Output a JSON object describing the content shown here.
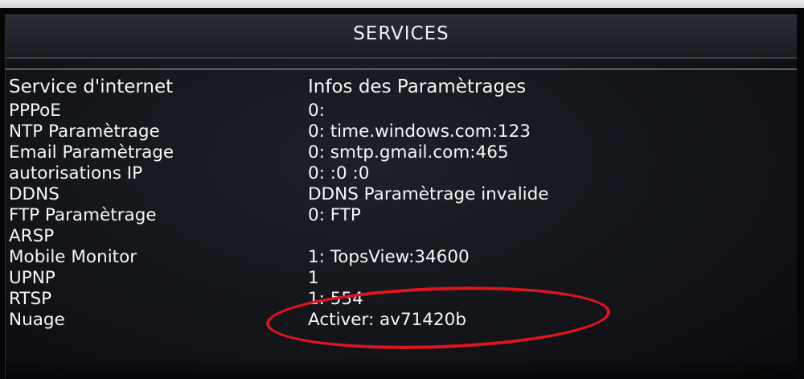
{
  "window": {
    "title": "SERVICES"
  },
  "table": {
    "headers": [
      "Service d'internet",
      "Infos des Paramètrages"
    ],
    "rows": [
      {
        "service": "PPPoE",
        "info": "0:"
      },
      {
        "service": "NTP Paramètrage",
        "info": "0: time.windows.com:123"
      },
      {
        "service": "Email Paramètrage",
        "info": "0: smtp.gmail.com:465"
      },
      {
        "service": "autorisations IP",
        "info": "0: :0 :0"
      },
      {
        "service": "DDNS",
        "info": "DDNS Paramètrage invalide"
      },
      {
        "service": "FTP Paramètrage",
        "info": "0: FTP"
      },
      {
        "service": "ARSP",
        "info": ""
      },
      {
        "service": "Mobile Monitor",
        "info": "1: TopsView:34600"
      },
      {
        "service": "UPNP",
        "info": "1"
      },
      {
        "service": "RTSP",
        "info": "1: 554"
      },
      {
        "service": "Nuage",
        "info": "Activer: av71420b"
      }
    ]
  },
  "colors": {
    "highlight": "#e0141c",
    "text": "#f6f7fa",
    "background": "#121419"
  }
}
